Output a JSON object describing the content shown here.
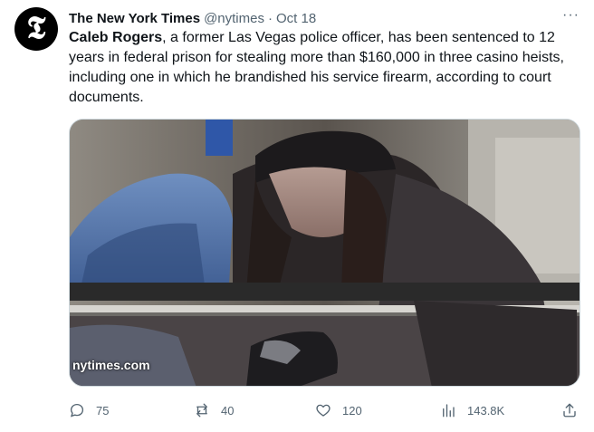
{
  "author": {
    "name": "The New York Times",
    "handle": "@nytimes",
    "separator": "·",
    "date": "Oct 18",
    "avatar_glyph": "𝕿"
  },
  "menu_label": "···",
  "tweet": {
    "lead": "Caleb Rogers",
    "body": ", a former Las Vegas police officer, has been sentenced to 12 years in federal prison for stealing more than $160,000 in three casino heists, including one in which he brandished his service firearm, according to court documents."
  },
  "media": {
    "watermark": "nytimes.com",
    "alt_subject": "photo"
  },
  "actions": {
    "replies": "75",
    "retweets": "40",
    "likes": "120",
    "views": "143.8K"
  },
  "icons": {
    "reply": "reply-icon",
    "retweet": "retweet-icon",
    "like": "heart-icon",
    "views": "views-icon",
    "share": "share-icon",
    "more": "more-icon"
  },
  "colors": {
    "text": "#0f1419",
    "secondary": "#536471",
    "border": "#cfd9de"
  }
}
